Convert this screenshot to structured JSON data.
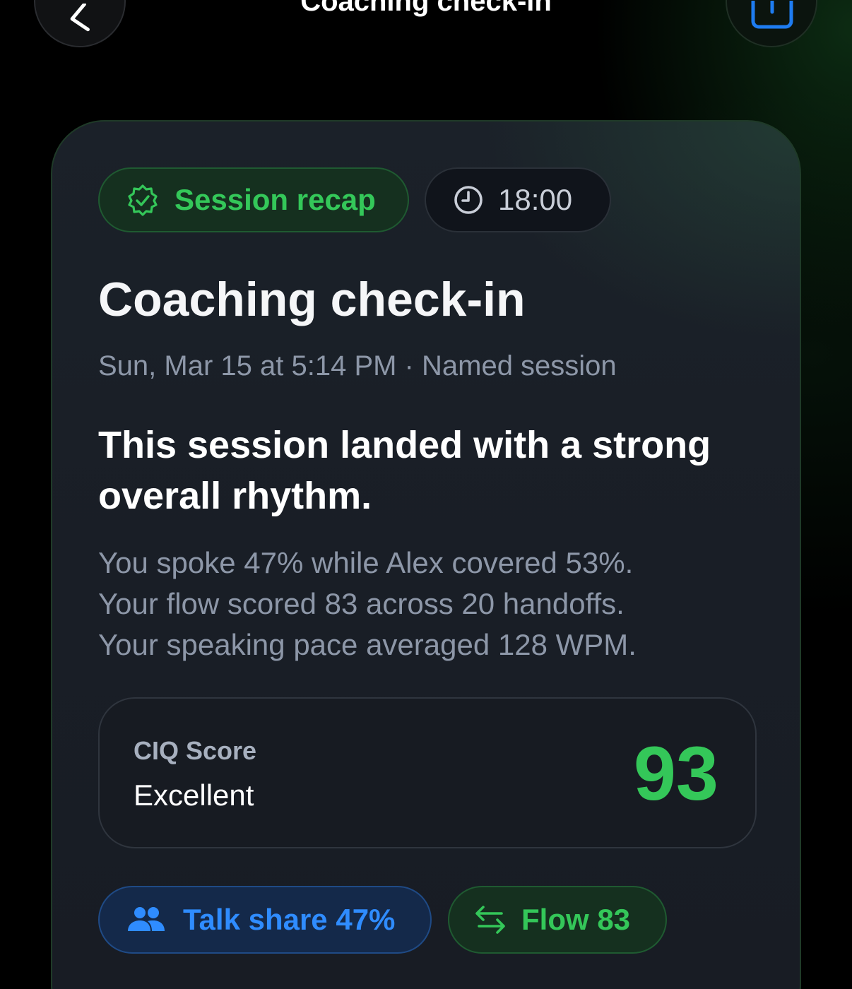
{
  "nav": {
    "title": "Coaching check-in",
    "back_icon": "chevron-left-icon",
    "share_icon": "share-icon"
  },
  "card": {
    "badge": {
      "label": "Session recap",
      "icon": "verified-badge-icon",
      "color": "#34c759"
    },
    "duration": {
      "label": "18:00",
      "icon": "clock-icon"
    },
    "title": "Coaching check-in",
    "meta": "Sun, Mar 15 at 5:14 PM · Named session",
    "headline": "This session landed with a strong overall rhythm.",
    "summary": [
      "You spoke 47% while Alex covered 53%.",
      "Your flow scored 83 across 20 handoffs.",
      "Your speaking pace averaged 128 WPM."
    ],
    "score": {
      "label": "CIQ Score",
      "grade": "Excellent",
      "value": "93",
      "color": "#34c759"
    },
    "chips": {
      "talk_share": {
        "label": "Talk share 47%",
        "icon": "people-icon",
        "color": "#2f8cff"
      },
      "flow": {
        "label": "Flow 83",
        "icon": "arrows-exchange-icon",
        "color": "#34c759"
      }
    }
  }
}
